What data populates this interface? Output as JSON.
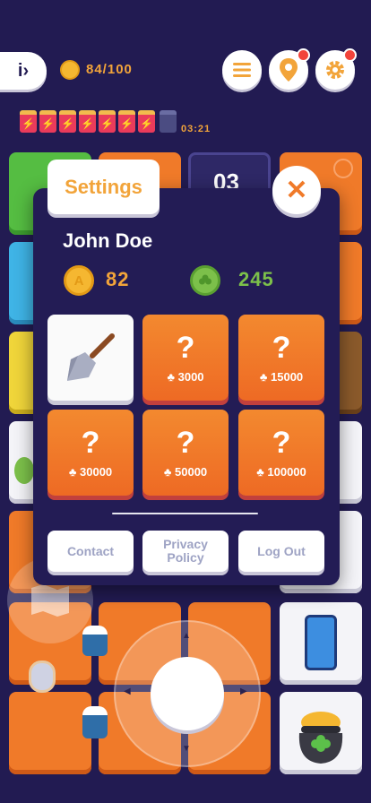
{
  "topbar": {
    "coins": "84/100",
    "timer": "03:21",
    "energy_full": 7,
    "energy_total": 8
  },
  "board": {
    "counter": "03"
  },
  "modal": {
    "title": "Settings",
    "close": "✕",
    "username": "John Doe",
    "coin_count": "82",
    "clover_count": "245",
    "items": [
      {
        "type": "shovel"
      },
      {
        "type": "mystery",
        "label": "?",
        "price": "3000"
      },
      {
        "type": "mystery",
        "label": "?",
        "price": "15000"
      },
      {
        "type": "mystery",
        "label": "?",
        "price": "30000"
      },
      {
        "type": "mystery",
        "label": "?",
        "price": "50000"
      },
      {
        "type": "mystery",
        "label": "?",
        "price": "100000"
      }
    ],
    "footer": {
      "contact": "Contact",
      "privacy": "Privacy Policy",
      "logout": "Log Out"
    }
  },
  "colors": {
    "background": "#221b52",
    "accent_orange": "#f07a29",
    "coin_gold": "#f5b731",
    "clover_green": "#7cc04a",
    "text_orange": "#f2a43a"
  }
}
